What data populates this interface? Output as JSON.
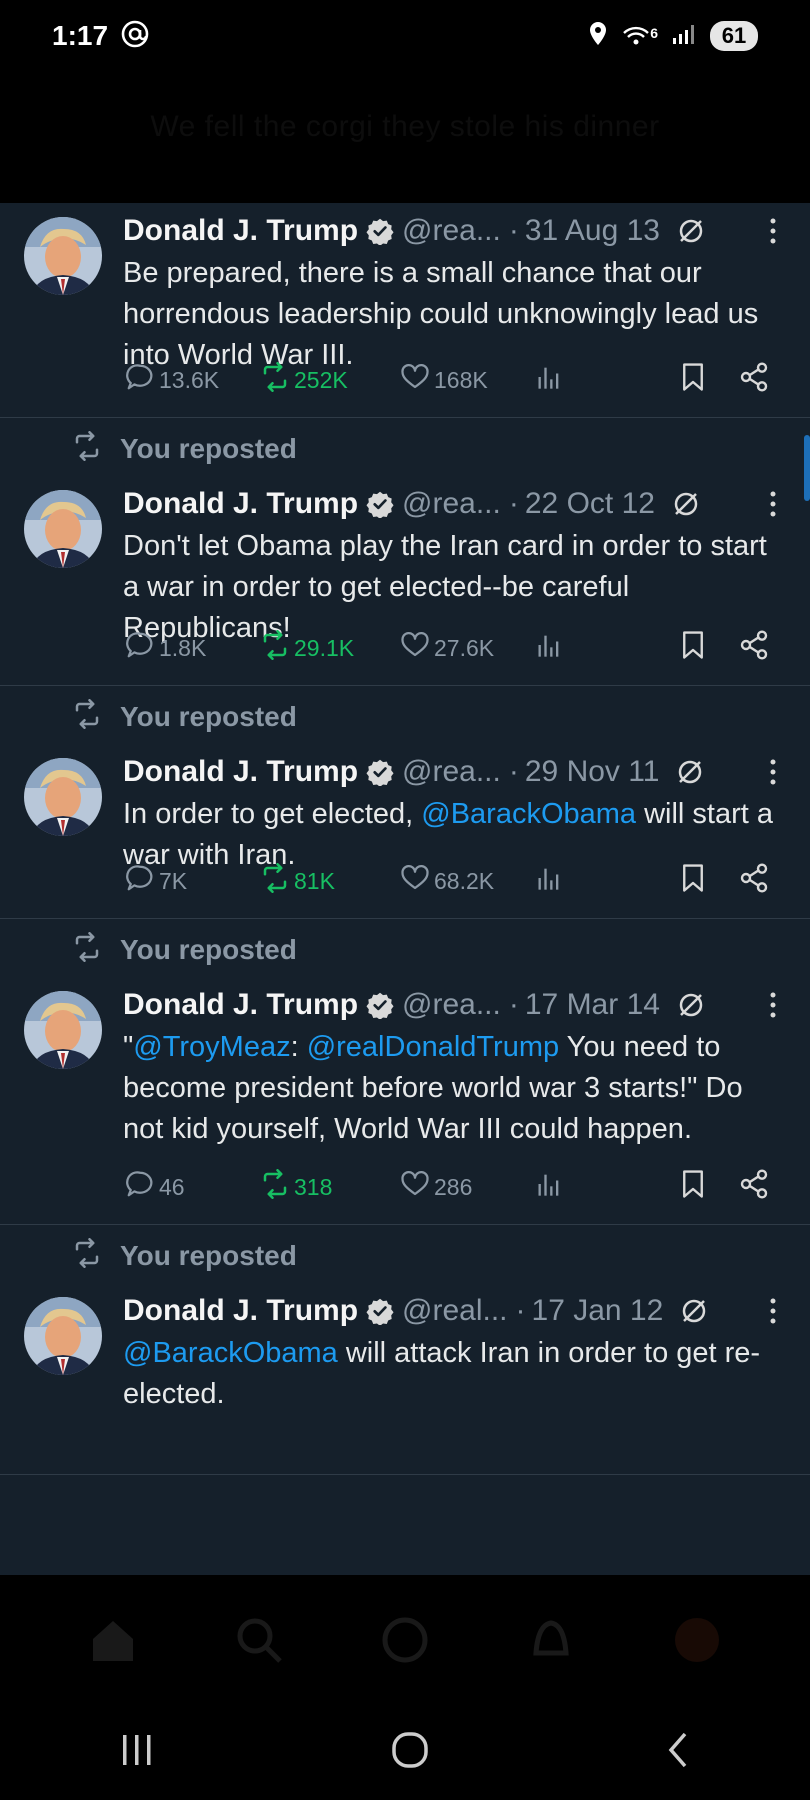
{
  "status_bar": {
    "time": "1:17",
    "battery": "61",
    "network": "6"
  },
  "ghost_caption": "We fell the corgi they stole his dinner",
  "posts": [
    {
      "repost_label": "",
      "author": "Donald J. Trump",
      "handle": "@rea...",
      "date": "31 Aug 13",
      "text_segments": [
        {
          "text": "Be prepared, there is a small chance that our horrendous leadership could unknowingly lead us into World War III.",
          "mention": false
        }
      ],
      "reply_count": "13.6K",
      "repost_count": "252K",
      "like_count": "168K"
    },
    {
      "repost_label": "You reposted",
      "author": "Donald J. Trump",
      "handle": "@rea...",
      "date": "22 Oct 12",
      "text_segments": [
        {
          "text": "Don't let Obama play the Iran card in order to start a war in order to get elected--be careful Republicans!",
          "mention": false
        }
      ],
      "reply_count": "1.8K",
      "repost_count": "29.1K",
      "like_count": "27.6K"
    },
    {
      "repost_label": "You reposted",
      "author": "Donald J. Trump",
      "handle": "@rea...",
      "date": "29 Nov 11",
      "text_segments": [
        {
          "text": "In order to get elected, ",
          "mention": false
        },
        {
          "text": "@BarackObama",
          "mention": true
        },
        {
          "text": " will start a war with Iran.",
          "mention": false
        }
      ],
      "reply_count": "7K",
      "repost_count": "81K",
      "like_count": "68.2K"
    },
    {
      "repost_label": "You reposted",
      "author": "Donald J. Trump",
      "handle": "@rea...",
      "date": "17 Mar 14",
      "text_segments": [
        {
          "text": "\"",
          "mention": false
        },
        {
          "text": "@TroyMeaz",
          "mention": true
        },
        {
          "text": ": ",
          "mention": false
        },
        {
          "text": "@realDonaldTrump",
          "mention": true
        },
        {
          "text": " You need to become president before world war 3 starts!\" Do not kid yourself, World War III could happen.",
          "mention": false
        }
      ],
      "reply_count": "46",
      "repost_count": "318",
      "like_count": "286"
    },
    {
      "repost_label": "You reposted",
      "author": "Donald J. Trump",
      "handle": "@real...",
      "date": "17 Jan 12",
      "text_segments": [
        {
          "text": "@BarackObama",
          "mention": true
        },
        {
          "text": " will attack Iran in order to get re-elected.",
          "mention": false
        }
      ],
      "reply_count": "",
      "repost_count": "",
      "like_count": ""
    }
  ],
  "colors": {
    "background": "#000000",
    "feed": "#15202b",
    "mention": "#1d9bf0",
    "repost_green": "#17bf63",
    "muted": "#8b98a5"
  },
  "icons": [
    "wifi-icon",
    "location-icon",
    "signal-icon",
    "verified-icon",
    "slash-circle-icon",
    "more-vertical-icon",
    "reply-icon",
    "repost-icon",
    "like-icon",
    "views-icon",
    "bookmark-icon",
    "share-icon",
    "home-icon",
    "search-icon",
    "grok-icon",
    "bell-icon",
    "profile-icon",
    "recents-icon",
    "home-circle-icon",
    "back-icon"
  ]
}
